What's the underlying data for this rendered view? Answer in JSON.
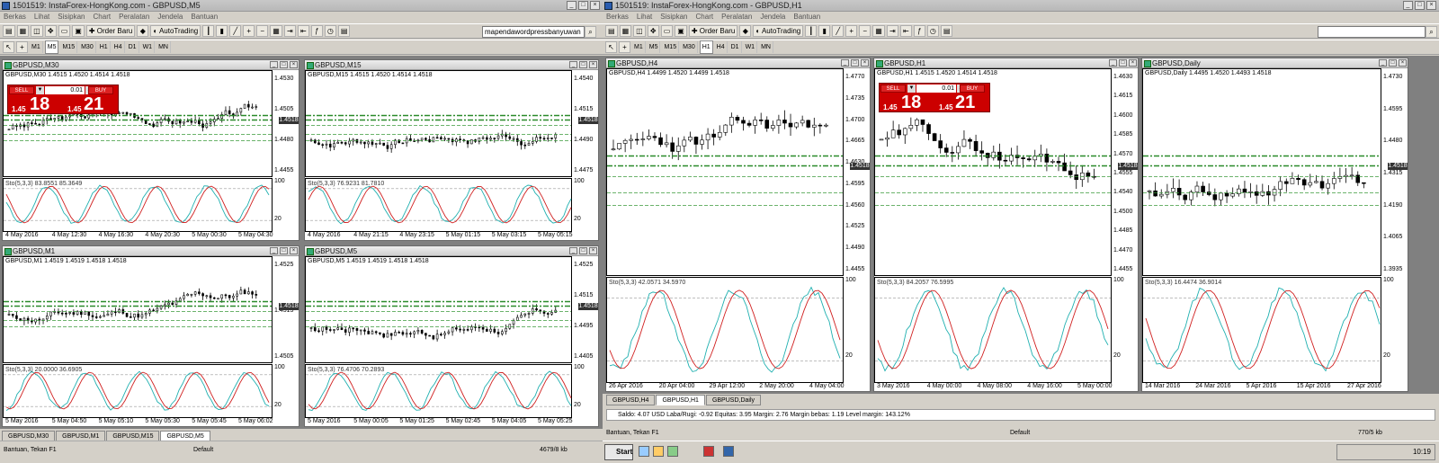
{
  "left": {
    "title": "1501519: InstaForex-HongKong.com - GBPUSD,M5",
    "menu": [
      "Berkas",
      "Lihat",
      "Sisipkan",
      "Chart",
      "Peralatan",
      "Jendela",
      "Bantuan"
    ],
    "order_label": "Order Baru",
    "autotrading_label": "AutoTrading",
    "search_value": "mapendawordpressbanyuwan",
    "timeframes": [
      "M1",
      "M5",
      "M15",
      "M30",
      "H1",
      "H4",
      "D1",
      "W1",
      "MN"
    ],
    "active_tf": "M5",
    "tabs": [
      "GBPUSD,M30",
      "GBPUSD,M1",
      "GBPUSD,M15",
      "GBPUSD,M5"
    ],
    "active_tab": "GBPUSD,M5",
    "status_help": "Bantuan, Tekan F1",
    "status_profile": "Default",
    "status_traffic": "4679/8 kb"
  },
  "right": {
    "title": "1501519: InstaForex-HongKong.com - GBPUSD,H1",
    "menu": [
      "Berkas",
      "Lihat",
      "Sisipkan",
      "Chart",
      "Peralatan",
      "Jendela",
      "Bantuan"
    ],
    "order_label": "Order Baru",
    "autotrading_label": "AutoTrading",
    "timeframes": [
      "M1",
      "M5",
      "M15",
      "M30",
      "H1",
      "H4",
      "D1",
      "W1",
      "MN"
    ],
    "active_tf": "H1",
    "tabs": [
      "GBPUSD,H4",
      "GBPUSD,H1",
      "GBPUSD,Daily"
    ],
    "active_tab": "GBPUSD,H1",
    "balance": "Saldo: 4.07 USD  Laba/Rugi: -0.92  Equitas: 3.95  Margin: 2.76  Margin bebas: 1.19  Level margin: 143.12%",
    "status_help": "Bantuan, Tekan F1",
    "status_profile": "Default",
    "status_traffic": "770/5 kb",
    "start": "Start",
    "clock": "10:19"
  },
  "trade_panel": {
    "sell": "SELL",
    "buy": "BUY",
    "lot": "0.01",
    "sell_small": "1.45",
    "sell_big": "18",
    "buy_small": "1.45",
    "buy_big": "21"
  },
  "charts": [
    {
      "id": "m30",
      "title": "GBPUSD,M30",
      "info": "GBPUSD,M30  1.4515 1.4520 1.4514 1.4518",
      "sto": "Sto(5,3,3) 83.8551 85.3649",
      "trade": true,
      "prices": [
        "1.4530",
        "1.4505",
        "1.4480",
        "1.4455"
      ],
      "dates": [
        "4 May 2016",
        "4 May 12:30",
        "4 May 16:30",
        "4 May 20:30",
        "5 May 00:30",
        "5 May 04:30"
      ],
      "last": "1.4518",
      "seed": 3,
      "trend": 0.2
    },
    {
      "id": "m15",
      "title": "GBPUSD,M15",
      "info": "GBPUSD,M15  1.4515 1.4520 1.4514 1.4518",
      "sto": "Sto(5,3,3) 76.9231 81.7810",
      "trade": false,
      "prices": [
        "1.4540",
        "1.4515",
        "1.4490",
        "1.4475"
      ],
      "dates": [
        "4 May 2016",
        "4 May 21:15",
        "4 May 23:15",
        "5 May 01:15",
        "5 May 03:15",
        "5 May 05:15"
      ],
      "last": "1.4518",
      "seed": 7,
      "trend": 0.8
    },
    {
      "id": "m1",
      "title": "GBPUSD,M1",
      "info": "GBPUSD,M1  1.4519 1.4519 1.4518 1.4518",
      "sto": "Sto(5,3,3) 20.0000 36.6905",
      "trade": false,
      "prices": [
        "1.4525",
        "1.4515",
        "1.4505"
      ],
      "dates": [
        "5 May 2016",
        "5 May 04:50",
        "5 May 05:10",
        "5 May 05:30",
        "5 May 05:45",
        "5 May 06:02"
      ],
      "last": "1.4518",
      "seed": 11,
      "trend": 0.4
    },
    {
      "id": "m5",
      "title": "GBPUSD,M5",
      "info": "GBPUSD,M5  1.4519 1.4519 1.4518 1.4518",
      "sto": "Sto(5,3,3) 76.4706 70.2893",
      "trade": false,
      "prices": [
        "1.4525",
        "1.4515",
        "1.4495",
        "1.4405"
      ],
      "dates": [
        "5 May 2016",
        "5 May 00:05",
        "5 May 01:25",
        "5 May 02:45",
        "5 May 04:05",
        "5 May 05:25"
      ],
      "last": "1.4518",
      "seed": 17,
      "trend": 1.0
    },
    {
      "id": "h4",
      "title": "GBPUSD,H4",
      "info": "GBPUSD,H4  1.4499 1.4520 1.4499 1.4518",
      "sto": "Sto(5,3,3) 42.0571 34.5970",
      "trade": false,
      "prices": [
        "1.4770",
        "1.4735",
        "1.4700",
        "1.4665",
        "1.4630",
        "1.4595",
        "1.4560",
        "1.4525",
        "1.4490",
        "1.4455"
      ],
      "dates": [
        "26 Apr 2016",
        "20 Apr 04:00",
        "29 Apr 12:00",
        "2 May 20:00",
        "4 May 04:00"
      ],
      "last": "1.4518",
      "seed": 23,
      "trend": -0.3
    },
    {
      "id": "h1",
      "title": "GBPUSD,H1",
      "info": "GBPUSD,H1  1.4515 1.4520 1.4514 1.4518",
      "sto": "Sto(5,3,3) 84.2057 76.5995",
      "trade": true,
      "prices": [
        "1.4630",
        "1.4615",
        "1.4600",
        "1.4585",
        "1.4570",
        "1.4555",
        "1.4540",
        "1.4500",
        "1.4485",
        "1.4470",
        "1.4455"
      ],
      "dates": [
        "3 May 2016",
        "4 May 00:00",
        "4 May 08:00",
        "4 May 16:00",
        "5 May 00:00"
      ],
      "last": "1.4518",
      "seed": 29,
      "trend": -0.5
    },
    {
      "id": "d1",
      "title": "GBPUSD,Daily",
      "info": "GBPUSD,Daily  1.4495 1.4520 1.4493 1.4518",
      "sto": "Sto(5,3,3) 16.4474 36.9014",
      "trade": false,
      "prices": [
        "1.4730",
        "1.4595",
        "1.4480",
        "1.4315",
        "1.4190",
        "1.4065",
        "1.3935"
      ],
      "dates": [
        "14 Mar 2016",
        "24 Mar 2016",
        "5 Apr 2016",
        "15 Apr 2016",
        "27 Apr 2016"
      ],
      "last": "1.4518",
      "seed": 41,
      "trend": 0.6
    }
  ]
}
